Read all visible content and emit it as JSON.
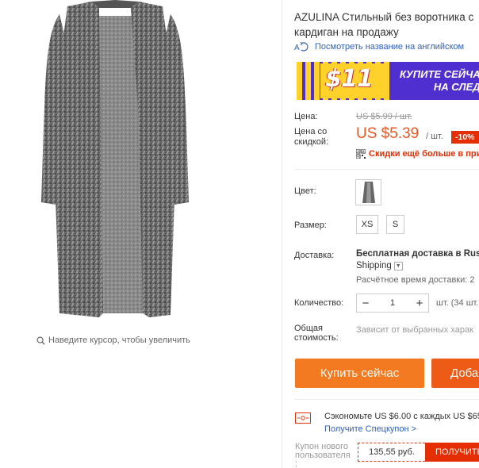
{
  "product": {
    "title_line1": "AZULINA Стильный без воротника с",
    "title_line2": "кардиган на продажу",
    "translate_link": "Посмотреть название на английском",
    "zoom_hint": "Наведите курсор, чтобы увеличить"
  },
  "banner": {
    "amount": "$11",
    "cta_line1": "КУПИТЕ СЕЙЧАС",
    "cta_line2": "НА СЛЕДУ"
  },
  "price": {
    "label": "Цена:",
    "old_price": "US $5.99 / шт.",
    "discount_label_line1": "Цена со",
    "discount_label_line2": "скидкой:",
    "current_price": "US $5.39",
    "per_unit": "/ шт.",
    "discount_badge": "-10%",
    "coupon_more": "Скидки ещё больше в при"
  },
  "options": {
    "color_label": "Цвет:",
    "size_label": "Размер:",
    "sizes": [
      "XS",
      "S"
    ]
  },
  "shipping": {
    "label": "Доставка:",
    "line": "Бесплатная доставка в Russ",
    "company": "Shipping",
    "time": "Расчётное время доставки: 2"
  },
  "quantity": {
    "label": "Количество:",
    "value": "1",
    "available": "шт. (34 шт."
  },
  "total": {
    "label_line1": "Общая",
    "label_line2": "стоимость:",
    "value": "Зависит от выбранных харак"
  },
  "actions": {
    "buy_now": "Купить сейчас",
    "add_cart": "Доба"
  },
  "promo": {
    "save_text": "Сэкономьте US $6.00 с каждых US $65",
    "save_link": "Получите Спецкупон >",
    "new_user_line1": "Купон нового",
    "new_user_line2": "пользователя",
    "new_user_line3": ":",
    "coupon_value": "135,55 руб.",
    "coupon_button": "ПОЛУЧИТЕ"
  },
  "colors": {
    "accent_orange": "#f47a21",
    "price_red": "#f0541e",
    "badge_red": "#e62e04",
    "link_blue": "#2f5fc1",
    "banner_purple": "#4f2fd0",
    "banner_yellow": "#ffd12a"
  }
}
